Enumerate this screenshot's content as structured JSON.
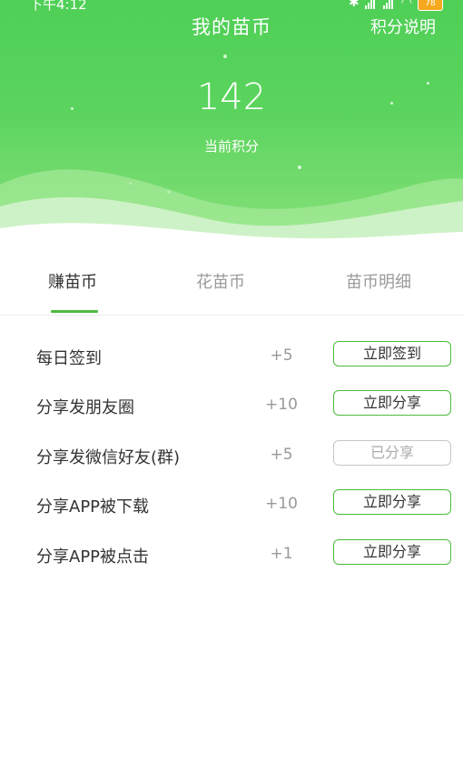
{
  "status_bar": {
    "time": "下午4:12",
    "battery": "78"
  },
  "header": {
    "title": "我的苗币",
    "rules_link": "积分说明",
    "points": "142",
    "points_label": "当前积分"
  },
  "tabs": [
    {
      "label": "赚苗币",
      "active": true
    },
    {
      "label": "花苗币",
      "active": false
    },
    {
      "label": "苗币明细",
      "active": false
    }
  ],
  "tasks": [
    {
      "name": "每日签到",
      "points": "+5",
      "button": "立即签到",
      "done": false
    },
    {
      "name": "分享发朋友圈",
      "points": "+10",
      "button": "立即分享",
      "done": false
    },
    {
      "name": "分享发微信好友(群)",
      "points": "+5",
      "button": "已分享",
      "done": true
    },
    {
      "name": "分享APP被下载",
      "points": "+10",
      "button": "立即分享",
      "done": false
    },
    {
      "name": "分享APP被点击",
      "points": "+1",
      "button": "立即分享",
      "done": false
    }
  ],
  "colors": {
    "accent": "#4cbb3e",
    "header_top": "#4fcf56",
    "header_bottom": "#8be37f",
    "disabled_border": "#c6c6c6"
  }
}
